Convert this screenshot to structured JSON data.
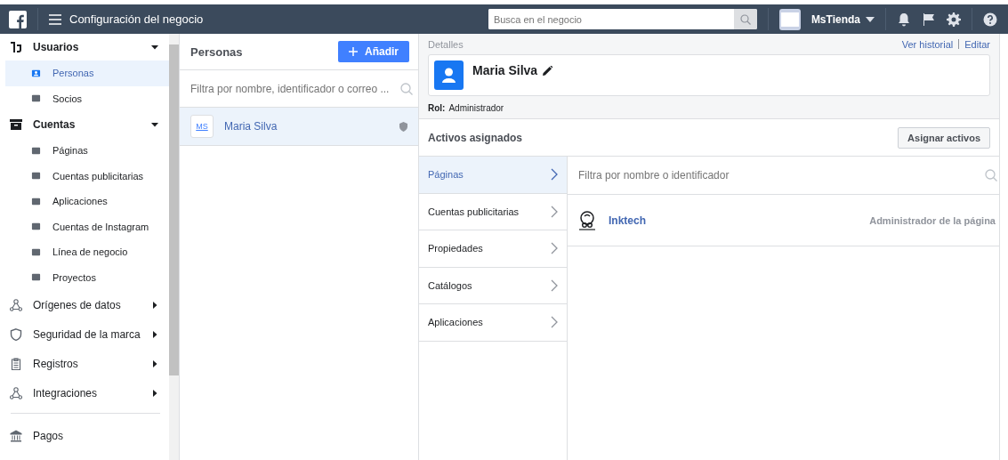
{
  "topbar": {
    "title": "Configuración del negocio",
    "search": {
      "placeholder": "Busca en el negocio"
    },
    "account": "MsTienda"
  },
  "sidebar": {
    "items": [
      {
        "kind": "group",
        "label": "Usuarios",
        "expanded": true,
        "children": [
          {
            "label": "Personas",
            "selected": true
          },
          {
            "label": "Socios",
            "selected": false
          }
        ]
      },
      {
        "kind": "group",
        "label": "Cuentas",
        "expanded": true,
        "children": [
          {
            "label": "Páginas",
            "selected": false
          },
          {
            "label": "Cuentas publicitarias",
            "selected": false
          },
          {
            "label": "Aplicaciones",
            "selected": false
          },
          {
            "label": "Cuentas de Instagram",
            "selected": false
          },
          {
            "label": "Línea de negocio",
            "selected": false
          },
          {
            "label": "Proyectos",
            "selected": false
          }
        ]
      },
      {
        "kind": "group",
        "label": "Orígenes de datos",
        "expanded": false
      },
      {
        "kind": "group",
        "label": "Seguridad de la marca",
        "expanded": false
      },
      {
        "kind": "group",
        "label": "Registros",
        "expanded": false
      },
      {
        "kind": "group",
        "label": "Integraciones",
        "expanded": false
      },
      {
        "kind": "link",
        "label": "Pagos"
      }
    ]
  },
  "people": {
    "title": "Personas",
    "add_button": "Añadir",
    "filter": {
      "placeholder": "Filtra por nombre, identificador o correo ..."
    },
    "rows": [
      {
        "initials": "MS",
        "name": "Maria Silva",
        "selected": true
      }
    ]
  },
  "details": {
    "heading": "Detalles",
    "links": [
      "Ver historial",
      "Editar"
    ],
    "name": "Maria Silva",
    "role_label": "Rol:",
    "role": "Administrador",
    "assets_title": "Activos asignados",
    "assign_button": "Asignar activos",
    "asset_tabs": [
      {
        "label": "Páginas",
        "selected": true
      },
      {
        "label": "Cuentas publicitarias",
        "selected": false
      },
      {
        "label": "Propiedades",
        "selected": false
      },
      {
        "label": "Catálogos",
        "selected": false
      },
      {
        "label": "Aplicaciones",
        "selected": false
      }
    ],
    "asset_filter": {
      "placeholder": "Filtra por nombre o identificador"
    },
    "assets": [
      {
        "name": "Inktech",
        "permission": "Administrador de la página"
      }
    ]
  }
}
